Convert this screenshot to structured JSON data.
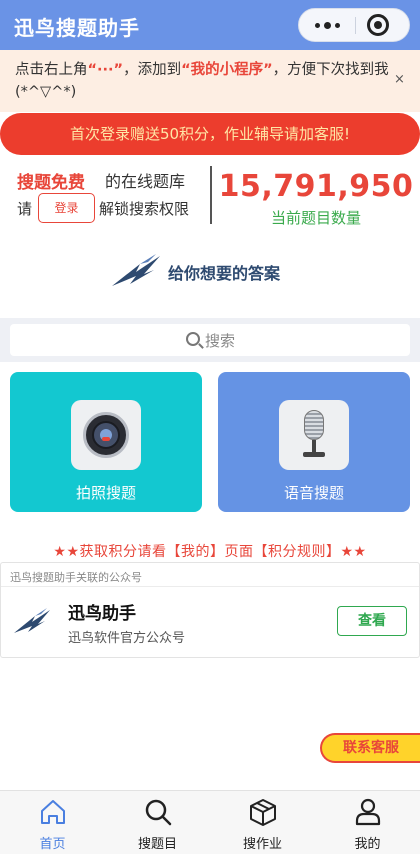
{
  "header": {
    "title": "迅鸟搜题助手"
  },
  "tip": {
    "part1": "点击右上角",
    "dots": "“···”",
    "part2": "，添加到",
    "mine": "“我的小程序”",
    "part3": "，方便下次找到我(*^▽^*)",
    "close": "×"
  },
  "banner": {
    "text": "首次登录赠送50积分，作业辅导请加客服!"
  },
  "info": {
    "free": "搜题免费",
    "online": "的在线题库",
    "qing": "请",
    "login_label": "登录",
    "unlock": "解锁搜索权限",
    "question_count": "15,791,950",
    "count_label": "当前题目数量"
  },
  "slogan": {
    "text": "给你想要的答案"
  },
  "search": {
    "placeholder": "搜索"
  },
  "cards": [
    {
      "label": "拍照搜题",
      "icon": "camera-icon",
      "color": "#13c8d0"
    },
    {
      "label": "语音搜题",
      "icon": "microphone-icon",
      "color": "#6593e4"
    }
  ],
  "rules": {
    "text": "★★获取积分请看【我的】页面【积分规则】★★"
  },
  "official_account": {
    "header": "迅鸟搜题助手关联的公众号",
    "name": "迅鸟助手",
    "desc": "迅鸟软件官方公众号",
    "view_label": "查看"
  },
  "service": {
    "label": "联系客服"
  },
  "tabbar": {
    "active_color": "#4a7fe0",
    "items": [
      {
        "label": "首页",
        "icon": "home-icon",
        "active": true
      },
      {
        "label": "搜题目",
        "icon": "search-icon",
        "active": false
      },
      {
        "label": "搜作业",
        "icon": "box-icon",
        "active": false
      },
      {
        "label": "我的",
        "icon": "user-icon",
        "active": false
      }
    ]
  },
  "colors": {
    "accent_red": "#e8463a",
    "nav_blue": "#6a93e6",
    "green": "#3aaa4c"
  }
}
